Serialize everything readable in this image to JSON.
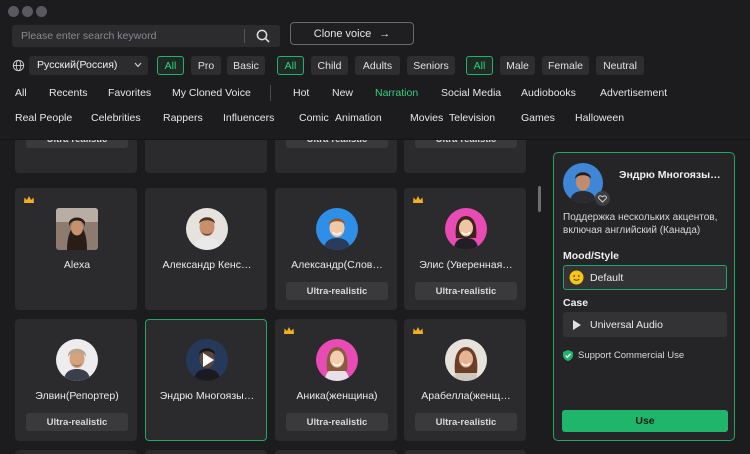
{
  "search": {
    "placeholder": "Please enter search keyword"
  },
  "header": {
    "clone_voice_label": "Clone voice",
    "clone_arrow": "→"
  },
  "filters": {
    "language": "Русский(Россия)",
    "tier": [
      "All",
      "Pro",
      "Basic"
    ],
    "age": [
      "All",
      "Child",
      "Adults",
      "Seniors"
    ],
    "gender": [
      "All",
      "Male",
      "Female",
      "Neutral"
    ]
  },
  "tabs_row1": [
    "All",
    "Recents",
    "Favorites",
    "My Cloned Voice",
    "Hot",
    "New",
    "Narration",
    "Social Media",
    "Audiobooks",
    "Advertisement"
  ],
  "tabs_row2": [
    "Real People",
    "Celebrities",
    "Rappers",
    "Influencers",
    "Comic",
    "Animation",
    "Movies",
    "Television",
    "Games",
    "Halloween"
  ],
  "active_tab": "Narration",
  "badge_text": "Ultra-realistic",
  "cards": [
    {
      "name": "Alexa",
      "badge": ""
    },
    {
      "name": "Александр Кенс…",
      "badge": ""
    },
    {
      "name": "Александр(Слов…",
      "badge": "Ultra-realistic"
    },
    {
      "name": "Элис (Уверенная…",
      "badge": "Ultra-realistic"
    },
    {
      "name": "Элвин(Репортер)",
      "badge": "Ultra-realistic"
    },
    {
      "name": "Эндрю Многоязы…",
      "badge": ""
    },
    {
      "name": "Аника(женщина)",
      "badge": "Ultra-realistic"
    },
    {
      "name": "Арабелла(женщ…",
      "badge": "Ultra-realistic"
    }
  ],
  "detail": {
    "title": "Эндрю Многоязы…",
    "description": "Поддержка нескольких акцентов, включая английский (Канада)",
    "mood_label": "Mood/Style",
    "mood_value": "Default",
    "case_label": "Case",
    "case_value": "Universal Audio",
    "commercial": "Support Commercial Use",
    "use_button": "Use"
  },
  "colors": {
    "accent": "#22a566",
    "background": "#1c1c1e",
    "card": "#2b2b2e",
    "crown": "#f2b01e"
  }
}
